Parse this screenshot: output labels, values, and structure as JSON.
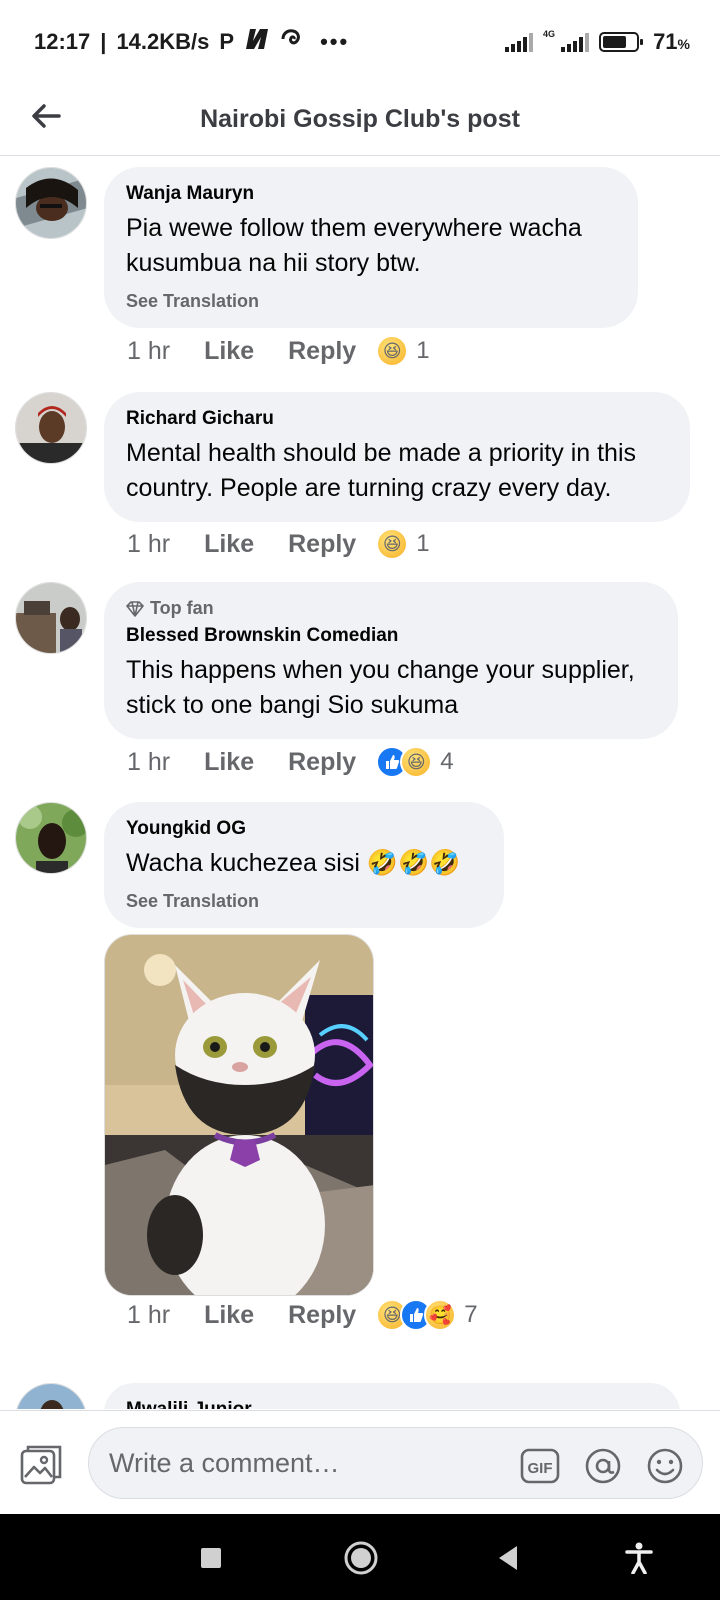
{
  "status_bar": {
    "time": "12:17",
    "speed": "14.2KB/s",
    "more": "•••",
    "network": "4G",
    "battery": "71",
    "battery_unit": "%",
    "battery_level": 0.71
  },
  "header": {
    "title": "Nairobi Gossip Club's post"
  },
  "comments": [
    {
      "author": "Wanja Mauryn",
      "text": "Pia wewe follow them everywhere wacha kusumbua na hii story btw.",
      "see_translation": "See Translation",
      "time": "1 hr",
      "like": "Like",
      "reply": "Reply",
      "reactions": [
        "haha"
      ],
      "reaction_count": "1"
    },
    {
      "author": "Richard Gicharu",
      "text": "Mental health should be made a priority in this country. People are turning crazy every day.",
      "time": "1 hr",
      "like": "Like",
      "reply": "Reply",
      "reactions": [
        "haha"
      ],
      "reaction_count": "1"
    },
    {
      "badge": "Top fan",
      "author": "Blessed Brownskin Comedian",
      "text": "This happens when you change your supplier, stick to one bangi Sio sukuma",
      "time": "1 hr",
      "like": "Like",
      "reply": "Reply",
      "reactions": [
        "like",
        "haha"
      ],
      "reaction_count": "4"
    },
    {
      "author": "Youngkid OG",
      "text": "Wacha kuchezea sisi 🤣🤣🤣",
      "see_translation": "See Translation",
      "time": "1 hr",
      "like": "Like",
      "reply": "Reply",
      "reactions": [
        "haha",
        "like",
        "care"
      ],
      "reaction_count": "7"
    },
    {
      "author": "Mwalili Junior"
    }
  ],
  "composer": {
    "placeholder": "Write a comment…",
    "gif_label": "GIF"
  }
}
